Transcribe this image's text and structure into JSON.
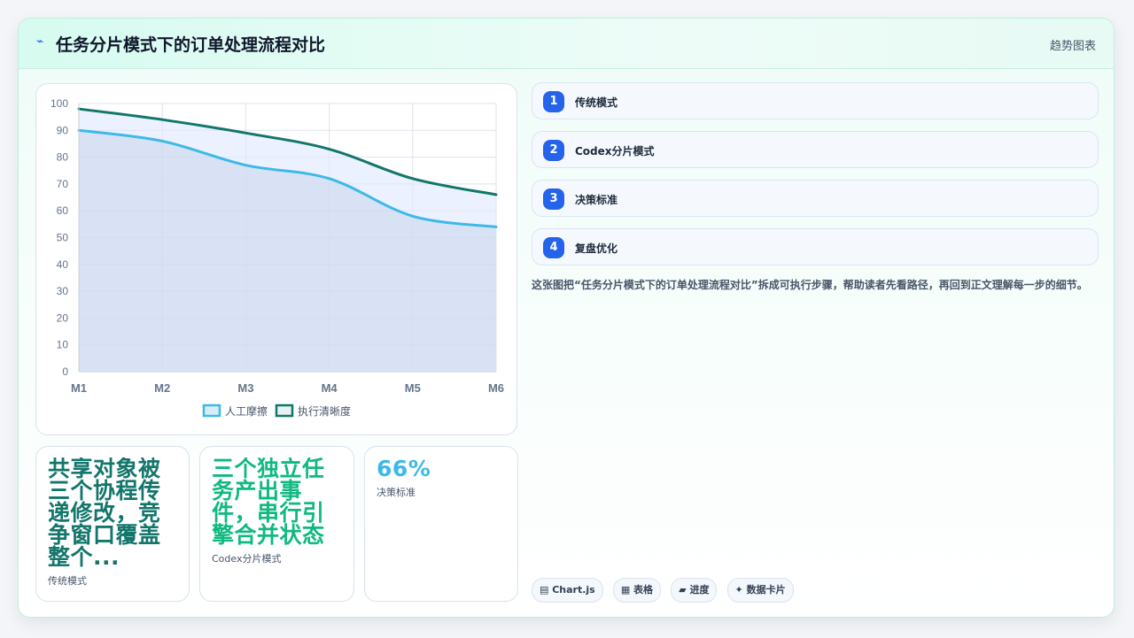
{
  "header": {
    "logo_icon": "⌁",
    "title": "任务分片模式下的订单处理流程对比",
    "tag": "趋势图表"
  },
  "chart_data": {
    "type": "area",
    "categories": [
      "M1",
      "M2",
      "M3",
      "M4",
      "M5",
      "M6"
    ],
    "series": [
      {
        "name": "人工摩擦",
        "values": [
          90,
          86,
          77,
          72,
          58,
          54
        ],
        "color": "#3db9e8"
      },
      {
        "name": "执行清晰度",
        "values": [
          98,
          94,
          89,
          83,
          72,
          66
        ],
        "color": "#13766b"
      }
    ],
    "ylim": [
      0,
      100
    ],
    "yticks": [
      0,
      10,
      20,
      30,
      40,
      50,
      60,
      70,
      80,
      90,
      100
    ],
    "grid": true,
    "legend": "bottom"
  },
  "kpis": [
    {
      "value": "共享对象被三个协程传递修改，竞争窗口覆盖整个...",
      "label": "传统模式",
      "color": "#13766b"
    },
    {
      "value": "三个独立任务产出事件，串行引擎合并状态",
      "label": "Codex分片模式",
      "color": "#10b981"
    },
    {
      "value": "66%",
      "label": "决策标准",
      "color": "#3db9e8"
    }
  ],
  "steps": [
    {
      "num": "1",
      "label": "传统模式"
    },
    {
      "num": "2",
      "label": "Codex分片模式"
    },
    {
      "num": "3",
      "label": "决策标准"
    },
    {
      "num": "4",
      "label": "复盘优化"
    }
  ],
  "description": "这张图把“任务分片模式下的订单处理流程对比”拆成可执行步骤，帮助读者先看路径，再回到正文理解每一步的细节。",
  "chips": [
    "▤ Chart.js",
    "▦ 表格",
    "▰ 进度",
    "✦ 数据卡片"
  ]
}
